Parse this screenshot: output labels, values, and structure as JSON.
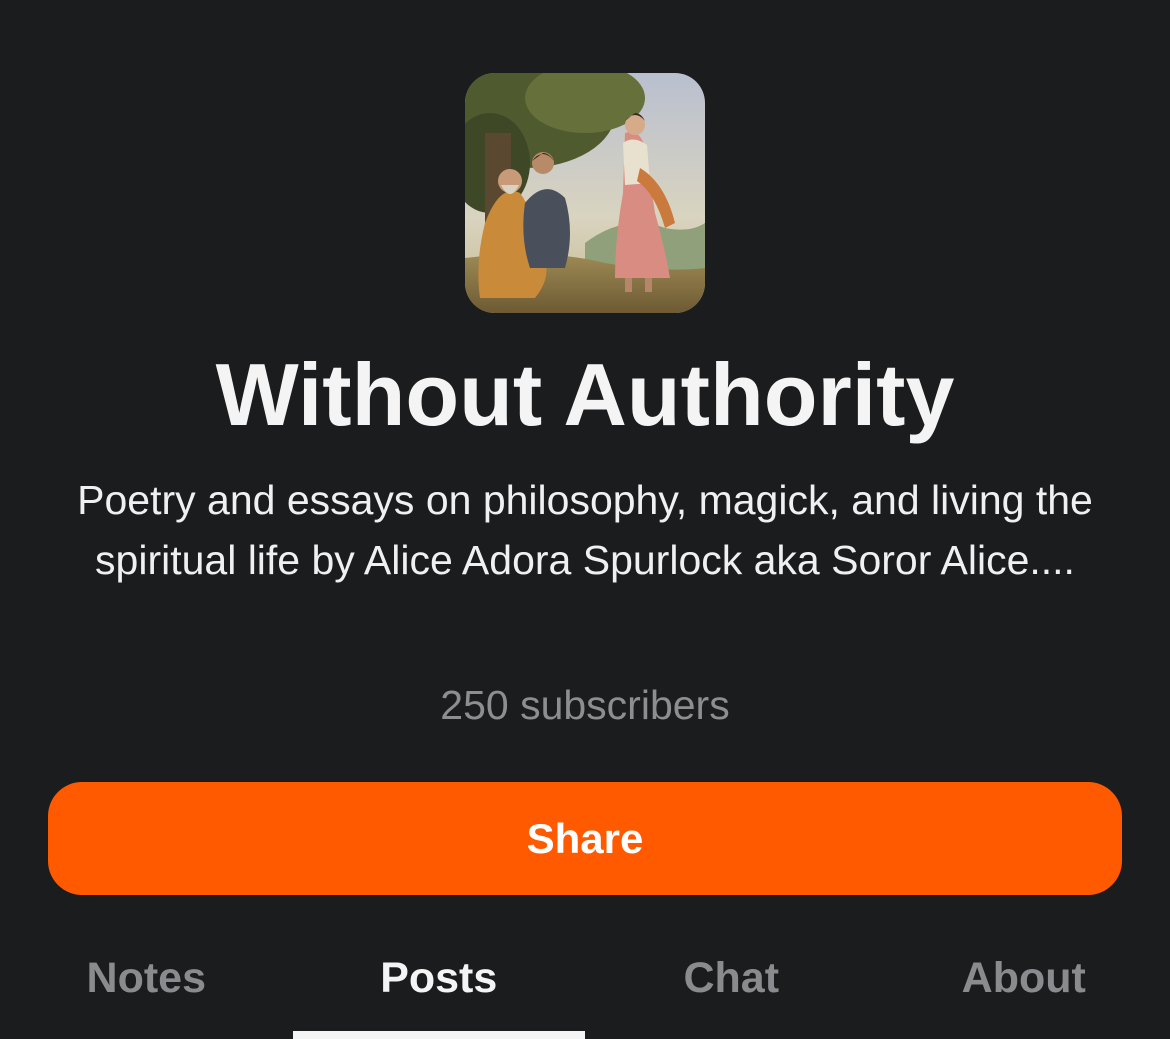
{
  "publication": {
    "cover_alt": "publication cover painting",
    "title": "Without Authority",
    "description": "Poetry and essays on philosophy, magick, and living the spiritual life by Alice Adora Spurlock aka Soror Alice....",
    "subscribers": "250 subscribers"
  },
  "actions": {
    "share_label": "Share"
  },
  "tabs": [
    {
      "label": "Notes",
      "active": false
    },
    {
      "label": "Posts",
      "active": true
    },
    {
      "label": "Chat",
      "active": false
    },
    {
      "label": "About",
      "active": false
    }
  ],
  "colors": {
    "background": "#1b1c1e",
    "accent": "#ff5a00",
    "muted_text": "#8d8e91"
  }
}
